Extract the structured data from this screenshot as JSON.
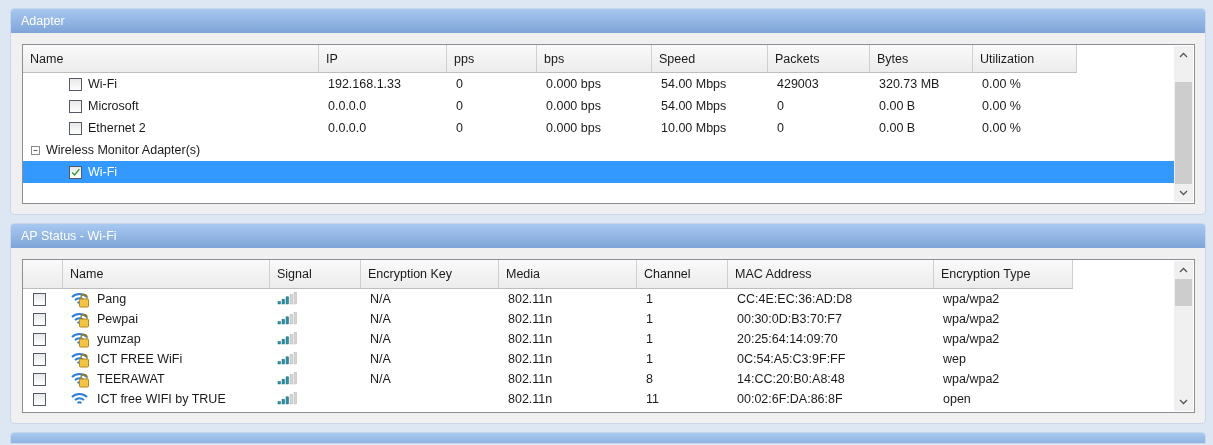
{
  "adapter_panel": {
    "title": "Adapter",
    "columns": [
      "Name",
      "IP",
      "pps",
      "bps",
      "Speed",
      "Packets",
      "Bytes",
      "Utilization"
    ],
    "rows": [
      {
        "kind": "adapter",
        "name": "Wi-Fi",
        "checked": false,
        "selected": false,
        "cells": [
          "192.168.1.33",
          "0",
          "0.000 bps",
          "54.00 Mbps",
          "429003",
          "320.73 MB",
          "0.00 %"
        ]
      },
      {
        "kind": "adapter",
        "name": "Microsoft",
        "checked": false,
        "selected": false,
        "cells": [
          "0.0.0.0",
          "0",
          "0.000 bps",
          "54.00 Mbps",
          "0",
          "0.00 B",
          "0.00 %"
        ]
      },
      {
        "kind": "adapter",
        "name": "Ethernet 2",
        "checked": false,
        "selected": false,
        "cells": [
          "0.0.0.0",
          "0",
          "0.000 bps",
          "10.00 Mbps",
          "0",
          "0.00 B",
          "0.00 %"
        ]
      },
      {
        "kind": "group",
        "name": "Wireless Monitor Adapter(s)",
        "expanded": true,
        "selected": false,
        "children": [
          {
            "kind": "adapter",
            "name": "Wi-Fi",
            "checked": true,
            "selected": true
          }
        ]
      }
    ]
  },
  "ap_panel": {
    "title": "AP Status - Wi-Fi",
    "columns": [
      "",
      "Name",
      "Signal",
      "Encryption Key",
      "Media",
      "Channel",
      "MAC Address",
      "Encryption Type"
    ],
    "rows": [
      {
        "checked": false,
        "secured": true,
        "name": "Pang",
        "encryption_key": "N/A",
        "media": "802.11n",
        "channel": "1",
        "mac": "CC:4E:EC:36:AD:D8",
        "encryption_type": "wpa/wpa2"
      },
      {
        "checked": false,
        "secured": true,
        "name": "Pewpai",
        "encryption_key": "N/A",
        "media": "802.11n",
        "channel": "1",
        "mac": "00:30:0D:B3:70:F7",
        "encryption_type": "wpa/wpa2"
      },
      {
        "checked": false,
        "secured": true,
        "name": "yumzap",
        "encryption_key": "N/A",
        "media": "802.11n",
        "channel": "1",
        "mac": "20:25:64:14:09:70",
        "encryption_type": "wpa/wpa2"
      },
      {
        "checked": false,
        "secured": true,
        "name": "ICT FREE WiFi",
        "encryption_key": "N/A",
        "media": "802.11n",
        "channel": "1",
        "mac": "0C:54:A5:C3:9F:FF",
        "encryption_type": "wep"
      },
      {
        "checked": false,
        "secured": true,
        "name": "TEERAWAT",
        "encryption_key": "N/A",
        "media": "802.11n",
        "channel": "8",
        "mac": "14:CC:20:B0:A8:48",
        "encryption_type": "wpa/wpa2"
      },
      {
        "checked": false,
        "secured": false,
        "name": "ICT free WIFI by TRUE",
        "media": "802.11n",
        "channel": "11",
        "mac": "00:02:6F:DA:86:8F",
        "encryption_type": "open"
      }
    ]
  }
}
